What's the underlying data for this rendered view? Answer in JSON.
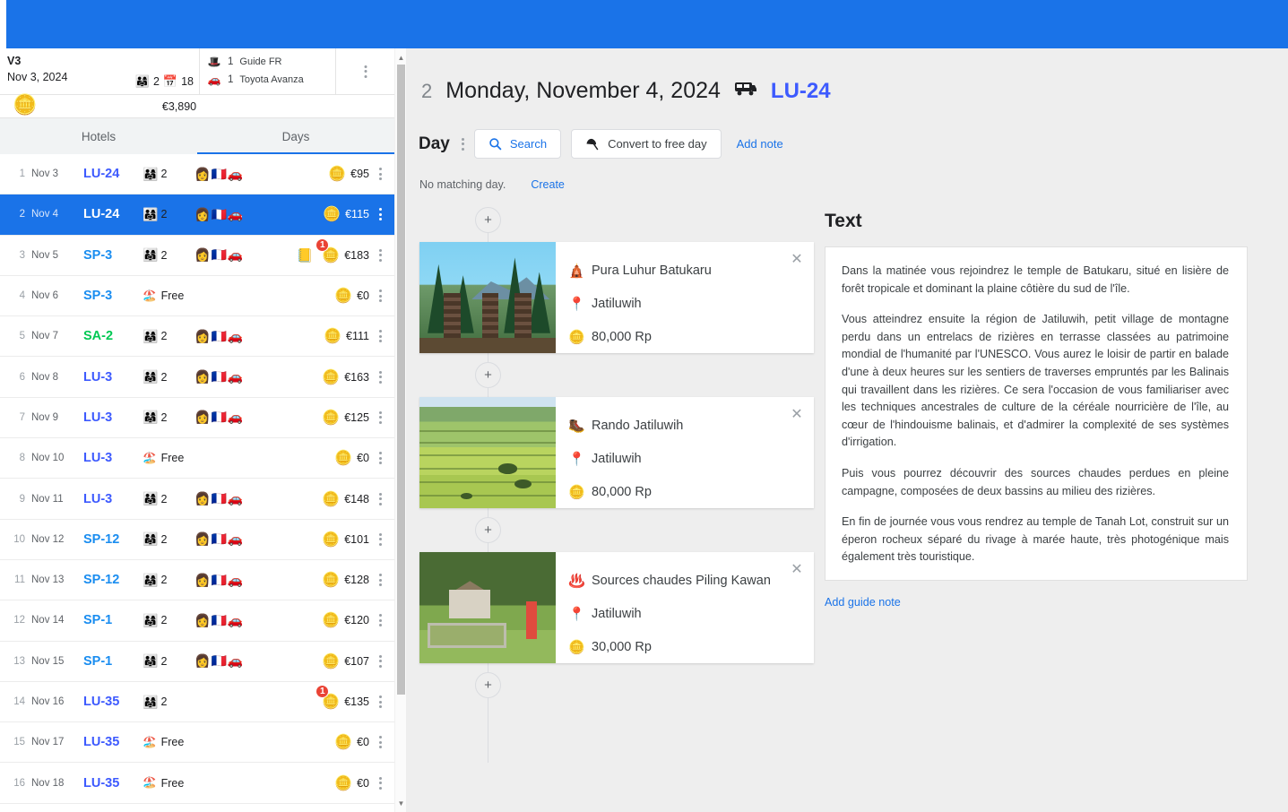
{
  "theme": {
    "brand_blue": "#1a73e8",
    "code_blue": "#3d5afe",
    "badge_red": "#ea4335"
  },
  "left_panel": {
    "trip": {
      "title": "V3",
      "date": "Nov 3, 2024",
      "pax_icon": "family-icon",
      "pax_count": "2",
      "calendar_icon": "calendar-icon",
      "days_count": "18",
      "total_price": "€3,890",
      "coins_icon": "coins-icon",
      "menu_icon": "kebab-menu-icon"
    },
    "resources": [
      {
        "icon": "guide-icon",
        "qty": "1",
        "label": "Guide FR"
      },
      {
        "icon": "car-icon",
        "qty": "1",
        "label": "Toyota Avanza"
      }
    ],
    "tabs": [
      {
        "label": "Hotels",
        "active": false
      },
      {
        "label": "Days",
        "active": true
      }
    ],
    "days": [
      {
        "idx": "1",
        "date": "Nov 3",
        "code": "LU-24",
        "code_color": "#3d5afe",
        "pax": "2",
        "free": false,
        "staff": true,
        "note": false,
        "badge": "",
        "cost": "€95",
        "selected": false
      },
      {
        "idx": "2",
        "date": "Nov 4",
        "code": "LU-24",
        "code_color": "#ffffff",
        "pax": "2",
        "free": false,
        "staff": true,
        "note": false,
        "badge": "",
        "cost": "€115",
        "selected": true
      },
      {
        "idx": "3",
        "date": "Nov 5",
        "code": "SP-3",
        "code_color": "#1a8df0",
        "pax": "2",
        "free": false,
        "staff": true,
        "note": true,
        "badge": "1",
        "cost": "€183",
        "selected": false
      },
      {
        "idx": "4",
        "date": "Nov 6",
        "code": "SP-3",
        "code_color": "#1a8df0",
        "pax": "",
        "free": true,
        "staff": false,
        "note": false,
        "badge": "",
        "cost": "€0",
        "selected": false
      },
      {
        "idx": "5",
        "date": "Nov 7",
        "code": "SA-2",
        "code_color": "#00c853",
        "pax": "2",
        "free": false,
        "staff": true,
        "note": false,
        "badge": "",
        "cost": "€111",
        "selected": false
      },
      {
        "idx": "6",
        "date": "Nov 8",
        "code": "LU-3",
        "code_color": "#3d5afe",
        "pax": "2",
        "free": false,
        "staff": true,
        "note": false,
        "badge": "",
        "cost": "€163",
        "selected": false
      },
      {
        "idx": "7",
        "date": "Nov 9",
        "code": "LU-3",
        "code_color": "#3d5afe",
        "pax": "2",
        "free": false,
        "staff": true,
        "note": false,
        "badge": "",
        "cost": "€125",
        "selected": false
      },
      {
        "idx": "8",
        "date": "Nov 10",
        "code": "LU-3",
        "code_color": "#3d5afe",
        "pax": "",
        "free": true,
        "staff": false,
        "note": false,
        "badge": "",
        "cost": "€0",
        "selected": false
      },
      {
        "idx": "9",
        "date": "Nov 11",
        "code": "LU-3",
        "code_color": "#3d5afe",
        "pax": "2",
        "free": false,
        "staff": true,
        "note": false,
        "badge": "",
        "cost": "€148",
        "selected": false
      },
      {
        "idx": "10",
        "date": "Nov 12",
        "code": "SP-12",
        "code_color": "#1a8df0",
        "pax": "2",
        "free": false,
        "staff": true,
        "note": false,
        "badge": "",
        "cost": "€101",
        "selected": false
      },
      {
        "idx": "11",
        "date": "Nov 13",
        "code": "SP-12",
        "code_color": "#1a8df0",
        "pax": "2",
        "free": false,
        "staff": true,
        "note": false,
        "badge": "",
        "cost": "€128",
        "selected": false
      },
      {
        "idx": "12",
        "date": "Nov 14",
        "code": "SP-1",
        "code_color": "#1a8df0",
        "pax": "2",
        "free": false,
        "staff": true,
        "note": false,
        "badge": "",
        "cost": "€120",
        "selected": false
      },
      {
        "idx": "13",
        "date": "Nov 15",
        "code": "SP-1",
        "code_color": "#1a8df0",
        "pax": "2",
        "free": false,
        "staff": true,
        "note": false,
        "badge": "",
        "cost": "€107",
        "selected": false
      },
      {
        "idx": "14",
        "date": "Nov 16",
        "code": "LU-35",
        "code_color": "#3d5afe",
        "pax": "2",
        "free": false,
        "staff": false,
        "note": false,
        "badge": "1",
        "cost": "€135",
        "selected": false
      },
      {
        "idx": "15",
        "date": "Nov 17",
        "code": "LU-35",
        "code_color": "#3d5afe",
        "pax": "",
        "free": true,
        "staff": false,
        "note": false,
        "badge": "",
        "cost": "€0",
        "selected": false
      },
      {
        "idx": "16",
        "date": "Nov 18",
        "code": "LU-35",
        "code_color": "#3d5afe",
        "pax": "",
        "free": true,
        "staff": false,
        "note": false,
        "badge": "",
        "cost": "€0",
        "selected": false
      }
    ],
    "free_label": "Free",
    "scrollbar": {
      "up_arrow": "▲",
      "down_arrow": "▼"
    }
  },
  "main": {
    "header": {
      "day_number": "2",
      "date_title": "Monday, November 4, 2024",
      "vehicle_icon": "bus-icon",
      "code": "LU-24"
    },
    "toolbar": {
      "label": "Day",
      "menu_icon": "kebab-menu-icon",
      "search_label": "Search",
      "search_icon": "search-icon",
      "convert_label": "Convert to free day",
      "convert_icon": "umbrella-icon",
      "add_note_label": "Add note"
    },
    "no_match": {
      "text": "No matching day.",
      "create_label": "Create"
    },
    "add_node_glyph": "+",
    "activities": [
      {
        "icon": "temple-icon",
        "title": "Pura Luhur Batukaru",
        "location_icon": "map-pin-icon",
        "location": "Jatiluwih",
        "price_icon": "coins-icon",
        "price": "80,000 Rp",
        "close_glyph": "✕",
        "thumb": "temple"
      },
      {
        "icon": "hiker-icon",
        "title": "Rando Jatiluwih",
        "location_icon": "map-pin-icon",
        "location": "Jatiluwih",
        "price_icon": "coins-icon",
        "price": "80,000 Rp",
        "close_glyph": "✕",
        "thumb": "rice"
      },
      {
        "icon": "hot-spring-icon",
        "title": "Sources chaudes Piling Kawan",
        "location_icon": "map-pin-icon",
        "location": "Jatiluwih",
        "price_icon": "coins-icon",
        "price": "30,000 Rp",
        "close_glyph": "✕",
        "thumb": "spring"
      }
    ],
    "text_panel": {
      "title": "Text",
      "paragraphs": [
        "Dans la matinée vous rejoindrez le temple de Batukaru, situé en lisière de forêt tropicale et dominant la plaine côtière du sud de l'île.",
        "Vous atteindrez ensuite la région de Jatiluwih, petit village de montagne perdu dans un entrelacs de rizières en terrasse classées au patrimoine mondial de l'humanité par l'UNESCO. Vous aurez le loisir de partir en balade d'une à deux heures sur les sentiers de traverses empruntés par les Balinais qui travaillent dans les rizières. Ce sera l'occasion de vous familiariser avec les techniques ancestrales de culture de la céréale nourricière de l'île, au cœur de l'hindouisme balinais, et d'admirer la complexité de ses systèmes d'irrigation.",
        "Puis vous pourrez découvrir des sources chaudes perdues en pleine campagne, composées de deux bassins au milieu des rizières.",
        "En fin de journée vous vous rendrez au temple de Tanah Lot, construit sur un éperon rocheux séparé du rivage à marée haute, très photogénique mais également très touristique."
      ],
      "add_guide_note_label": "Add guide note"
    }
  }
}
